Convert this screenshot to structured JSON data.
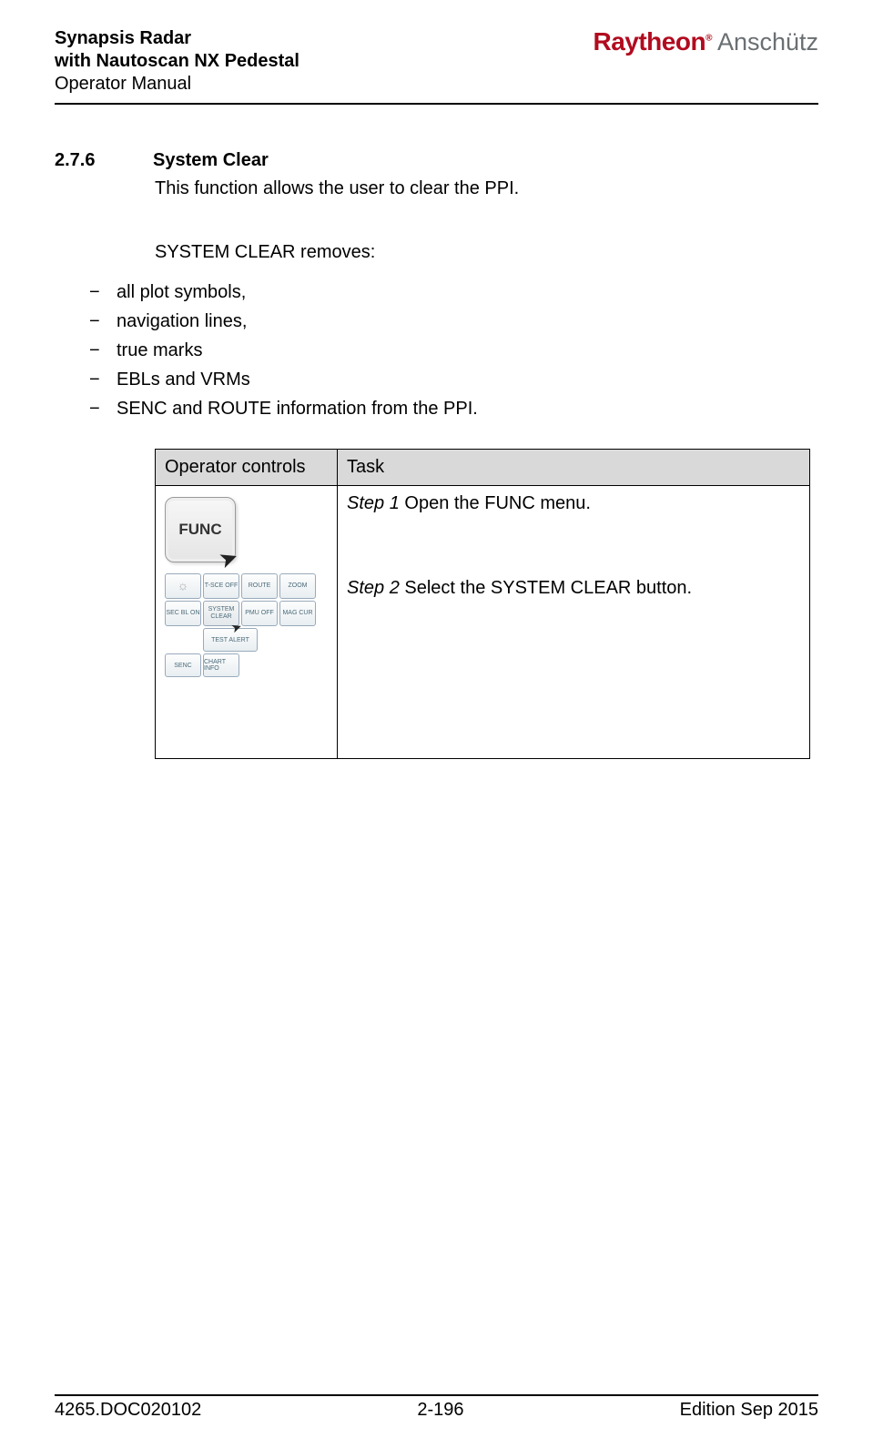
{
  "header": {
    "line1": "Synapsis Radar",
    "line2": "with Nautoscan NX Pedestal",
    "line3": "Operator Manual",
    "logo_brand": "Raytheon",
    "logo_sub": "Anschütz"
  },
  "section": {
    "number": "2.7.6",
    "title": "System Clear",
    "intro": "This function allows the user to clear the PPI.",
    "removes_label": "SYSTEM CLEAR removes:",
    "bullets": [
      "all plot symbols,",
      "navigation lines,",
      "true marks",
      "EBLs and VRMs",
      "SENC and ROUTE information from the PPI."
    ]
  },
  "table": {
    "col_operator": "Operator controls",
    "col_task": "Task",
    "func_label": "FUNC",
    "menu": {
      "r1c2": "T-SCE OFF",
      "r1c3": "ROUTE",
      "r1c4": "ZOOM",
      "r2c1": "SEC BL ON",
      "r2c2": "SYSTEM CLEAR",
      "r2c3": "PMU OFF",
      "r2c4": "MAG CUR",
      "r3_test": "TEST ALERT",
      "r4_senc": "SENC",
      "r4_chart": "CHART INFO"
    },
    "step1_label": "Step 1",
    "step1_text": " Open the FUNC menu.",
    "step2_label": "Step 2",
    "step2_text": " Select the SYSTEM CLEAR button."
  },
  "footer": {
    "doc": "4265.DOC020102",
    "page": "2-196",
    "edition": "Edition Sep 2015"
  }
}
